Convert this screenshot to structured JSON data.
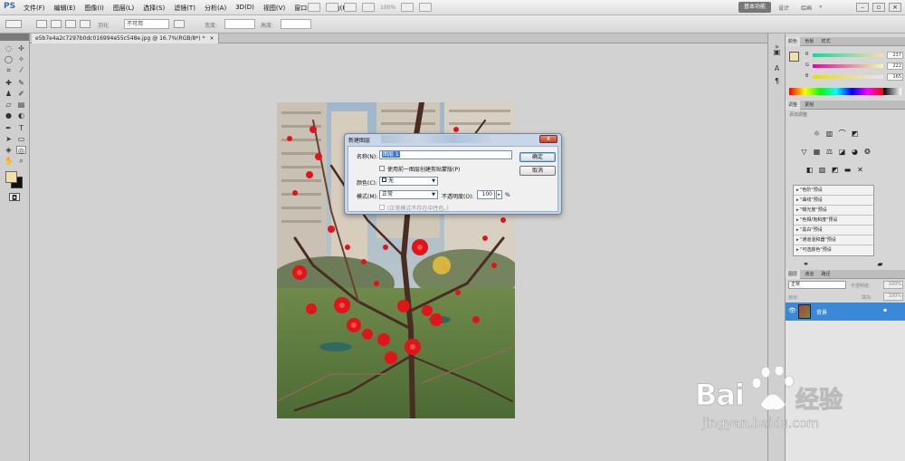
{
  "app": {
    "logo": "PS"
  },
  "menu": [
    "文件(F)",
    "编辑(E)",
    "图像(I)",
    "图层(L)",
    "选择(S)",
    "滤镜(T)",
    "分析(A)",
    "3D(D)",
    "视图(V)",
    "窗口(W)",
    "帮助(H)"
  ],
  "menu_zoom": "100%",
  "workspace": {
    "active": "基本功能",
    "design": "设计",
    "paint": "绘画",
    "more": "»"
  },
  "options": {
    "feather_label": "羽化",
    "style_value": "不可用",
    "width_label": "宽度:",
    "height_label": "高度:"
  },
  "document": {
    "tab_title": "e5b7e4a2c7297b0dc016994e55c548e.jpg @ 16.7%(RGB/8*) *"
  },
  "color_panel": {
    "tabs": [
      "颜色",
      "色板",
      "样式"
    ],
    "channels": [
      {
        "name": "R",
        "value": "237"
      },
      {
        "name": "G",
        "value": "222"
      },
      {
        "name": "B",
        "value": "165"
      }
    ]
  },
  "adjust_panel": {
    "tabs": [
      "调整",
      "蒙版"
    ],
    "heading": "添加调整",
    "presets": [
      "\"色阶\"预设",
      "\"曲线\"预设",
      "\"曝光度\"预设",
      "\"色相/饱和度\"预设",
      "\"黑白\"预设",
      "\"通道混和器\"预设",
      "\"可选颜色\"预设"
    ]
  },
  "layers_panel": {
    "tabs": [
      "图层",
      "通道",
      "路径"
    ],
    "blend_mode": "正常",
    "opacity_label": "不透明度:",
    "opacity": "100%",
    "lock_label": "锁定:",
    "fill_label": "填充:",
    "fill": "100%",
    "layer_name": "背景"
  },
  "dialog": {
    "title": "新建图层",
    "name_label": "名称(N):",
    "name_value": "图层 1",
    "clip_label": "使用前一图层创建剪贴蒙版(P)",
    "color_label": "颜色(C):",
    "color_value": "无",
    "mode_label": "模式(M):",
    "mode_value": "正常",
    "opacity_label": "不透明度(O):",
    "opacity_value": "100",
    "opacity_unit": "%",
    "neutral_label": "(正常模式不存在中性色。)",
    "ok": "确定",
    "cancel": "取消",
    "close_glyph": "x"
  },
  "watermark": {
    "brand": "Bai",
    "brand_cn": "经验",
    "url": "jingyan.baidu.com"
  },
  "colors": {
    "fg_swatch": "#f0dfa7",
    "bg_swatch": "#111111",
    "accent": "#3a88d8"
  }
}
